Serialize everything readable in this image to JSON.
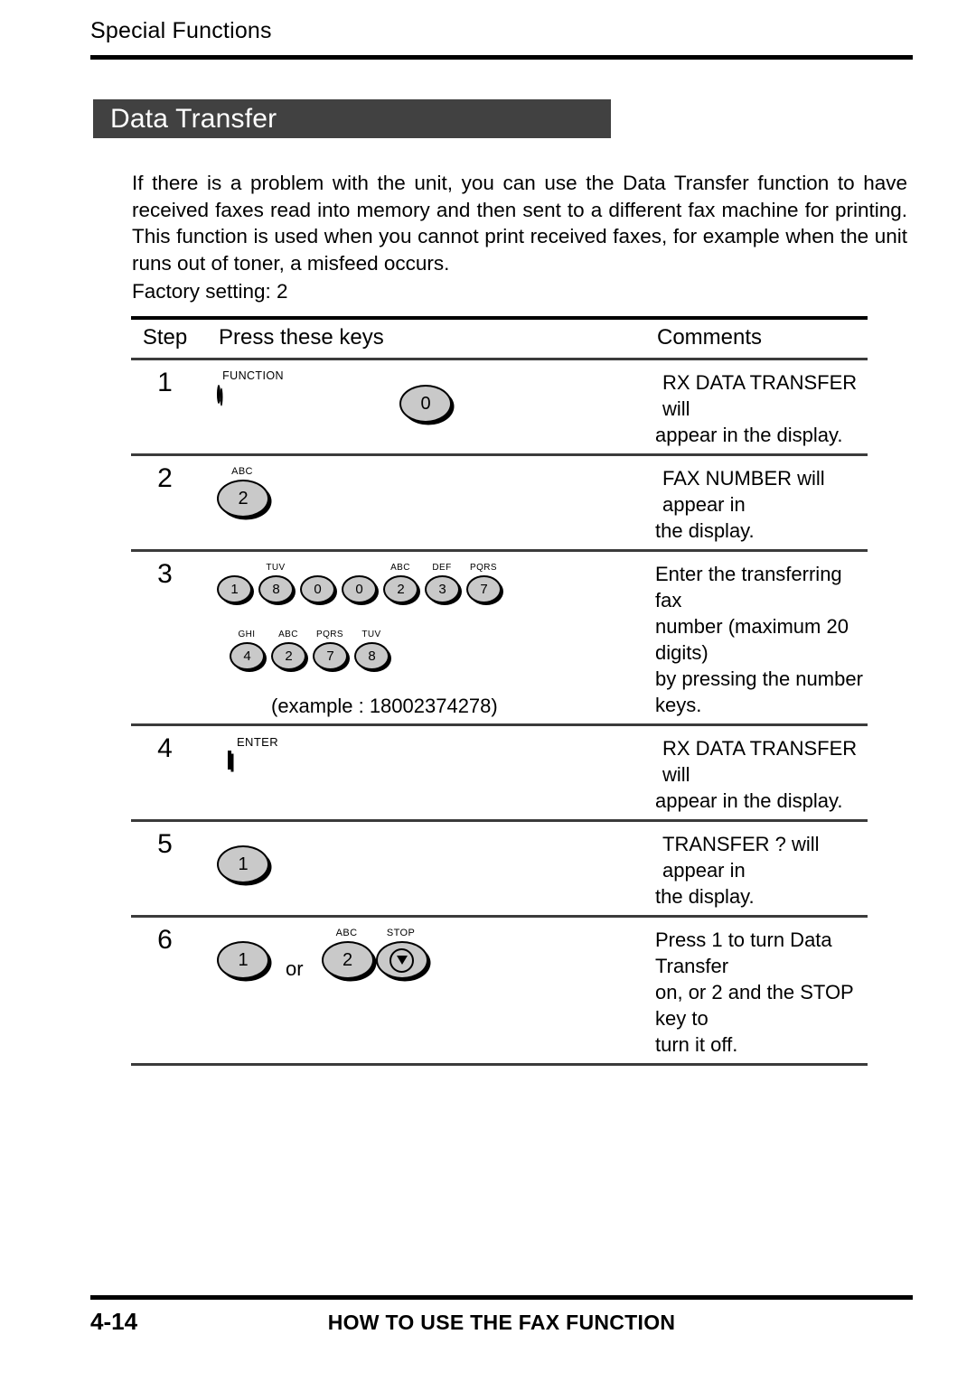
{
  "header": {
    "running_title": "Special Functions"
  },
  "section": {
    "title": "Data Transfer"
  },
  "intro": {
    "paragraph": "If there is a problem with the unit, you can use the Data Transfer function to have received faxes read into memory and then sent to a different fax machine for printing. This function is used when you cannot print received faxes, for example when the unit runs out of toner, a misfeed occurs.",
    "factory_setting": "Factory setting: 2"
  },
  "table": {
    "columns": {
      "step": "Step",
      "keys": "Press these keys",
      "comments": "Comments"
    },
    "rows": [
      {
        "step": "1",
        "keys": [
          {
            "type": "function",
            "label": "FUNCTION",
            "digit": ""
          },
          {
            "type": "spacer",
            "width": 96
          },
          {
            "type": "key-lg",
            "label": "",
            "digit": "0"
          }
        ],
        "comment_line1": "RX DATA TRANSFER  will",
        "comment_line2": "appear in the display."
      },
      {
        "step": "2",
        "keys": [
          {
            "type": "key-lg",
            "label": "ABC",
            "digit": "2"
          }
        ],
        "comment_line1": "FAX NUMBER  will appear in",
        "comment_line2": "the display."
      },
      {
        "step": "3",
        "keys_row1": [
          {
            "type": "key-sm",
            "label": "",
            "digit": "1"
          },
          {
            "type": "key-sm",
            "label": "TUV",
            "digit": "8"
          },
          {
            "type": "key-sm",
            "label": "",
            "digit": "0"
          },
          {
            "type": "key-sm",
            "label": "",
            "digit": "0"
          },
          {
            "type": "key-sm",
            "label": "ABC",
            "digit": "2"
          },
          {
            "type": "key-sm",
            "label": "DEF",
            "digit": "3"
          },
          {
            "type": "key-sm",
            "label": "PQRS",
            "digit": "7"
          }
        ],
        "keys_row2": [
          {
            "type": "key-sm",
            "label": "GHI",
            "digit": "4"
          },
          {
            "type": "key-sm",
            "label": "ABC",
            "digit": "2"
          },
          {
            "type": "key-sm",
            "label": "PQRS",
            "digit": "7"
          },
          {
            "type": "key-sm",
            "label": "TUV",
            "digit": "8"
          }
        ],
        "example": "(example : 18002374278)",
        "comment_line1": "Enter the transferring fax",
        "comment_line2": "number (maximum 20 digits)",
        "comment_line3": "by pressing the number keys."
      },
      {
        "step": "4",
        "keys": [
          {
            "type": "enter",
            "label": "ENTER",
            "digit": ""
          }
        ],
        "comment_line1": "RX DATA TRANSFER  will",
        "comment_line2": "appear in the display."
      },
      {
        "step": "5",
        "keys": [
          {
            "type": "key-lg",
            "label": "",
            "digit": "1"
          }
        ],
        "comment_line1": "TRANSFER ?  will appear in",
        "comment_line2": "the display."
      },
      {
        "step": "6",
        "keys": [
          {
            "type": "key-lg",
            "label": "",
            "digit": "1"
          },
          {
            "type": "or",
            "text": "or"
          },
          {
            "type": "key-lg",
            "label": "ABC",
            "digit": "2"
          },
          {
            "type": "key-stop",
            "label": "STOP",
            "digit": ""
          }
        ],
        "comment_line1": "Press 1 to turn Data Transfer",
        "comment_line2": "on, or 2 and the STOP key to",
        "comment_line3": "turn it off."
      }
    ]
  },
  "footer": {
    "page_number": "4-14",
    "title": "HOW TO USE THE FAX FUNCTION"
  },
  "colors": {
    "section_bar": "#414141",
    "key_face": "#c9c9c9",
    "rule": "#000000"
  }
}
